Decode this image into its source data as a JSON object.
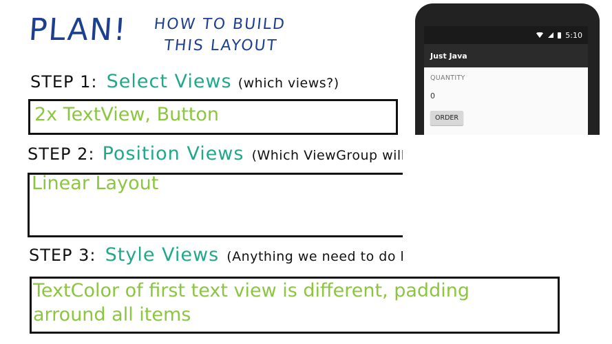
{
  "title": {
    "main": "PLAN!",
    "sub_line1": "HOW TO BUILD",
    "sub_line2": "THIS LAYOUT"
  },
  "steps": [
    {
      "label": "STEP 1:",
      "title": "Select Views",
      "question": "(which views?)",
      "answer": "2x TextView, Button"
    },
    {
      "label": "STEP 2:",
      "title": "Position Views",
      "question": "(Which ViewGroup will be root view?)",
      "answer": "Linear Layout"
    },
    {
      "label": "STEP 3:",
      "title": "Style Views",
      "question": "(Anything we need to do here?)",
      "answer_line1": "TextColor of first text view is different, padding",
      "answer_line2": "arround all items"
    }
  ],
  "phone": {
    "time": "5:10",
    "app_title": "Just Java",
    "quantity_label": "QUANTITY",
    "quantity_value": "0",
    "order_button": "ORDER"
  },
  "colors": {
    "title": "#1d3f8f",
    "step_title": "#1fa88a",
    "answer": "#8cc63f",
    "ink": "#111111"
  }
}
